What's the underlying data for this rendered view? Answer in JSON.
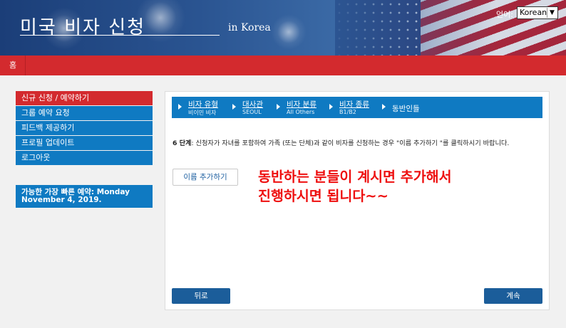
{
  "header": {
    "title": "미국 비자 신청",
    "subtitle": "in Korea",
    "language_label": "언어:",
    "language_selected": "Korean"
  },
  "nav": {
    "home_label": "홈"
  },
  "sidebar": {
    "items": [
      {
        "label": "신규 신청 / 예약하기",
        "active": true
      },
      {
        "label": "그룹 예약 요청",
        "active": false
      },
      {
        "label": "피드백 제공하기",
        "active": false
      },
      {
        "label": "프로필 업데이트",
        "active": false
      },
      {
        "label": "로그아웃",
        "active": false
      }
    ],
    "soonest_line1": "가능한 가장 빠른 예약: Monday",
    "soonest_line2": "November 4, 2019."
  },
  "steps": [
    {
      "label": "비자 유형",
      "value": "비이민 비자"
    },
    {
      "label": "대사관",
      "value": "SEOUL"
    },
    {
      "label": "비자 분류",
      "value": "All Others"
    },
    {
      "label": "비자 종류",
      "value": "B1/B2"
    },
    {
      "label": "동반인들",
      "value": ""
    }
  ],
  "main": {
    "step_prefix": "6 단계",
    "instruction": ": 신청자가 자녀를 포함하여 가족 (또는 단체)과 같이 비자를 신청하는 경우 \"이름 추가하기 \"를 클릭하시기 바랍니다.",
    "add_name_button": "이름 추가하기",
    "annotation_line1": "동반하는 분들이 계시면 추가해서",
    "annotation_line2": "진행하시면 됩니다~~",
    "back_button": "뒤로",
    "next_button": "계속"
  },
  "colors": {
    "header_blue": "#2a5491",
    "nav_red": "#d32a2e",
    "menu_blue": "#0f7ac2",
    "button_blue": "#1b5d9a",
    "annotation_red": "#ee0f0f"
  }
}
